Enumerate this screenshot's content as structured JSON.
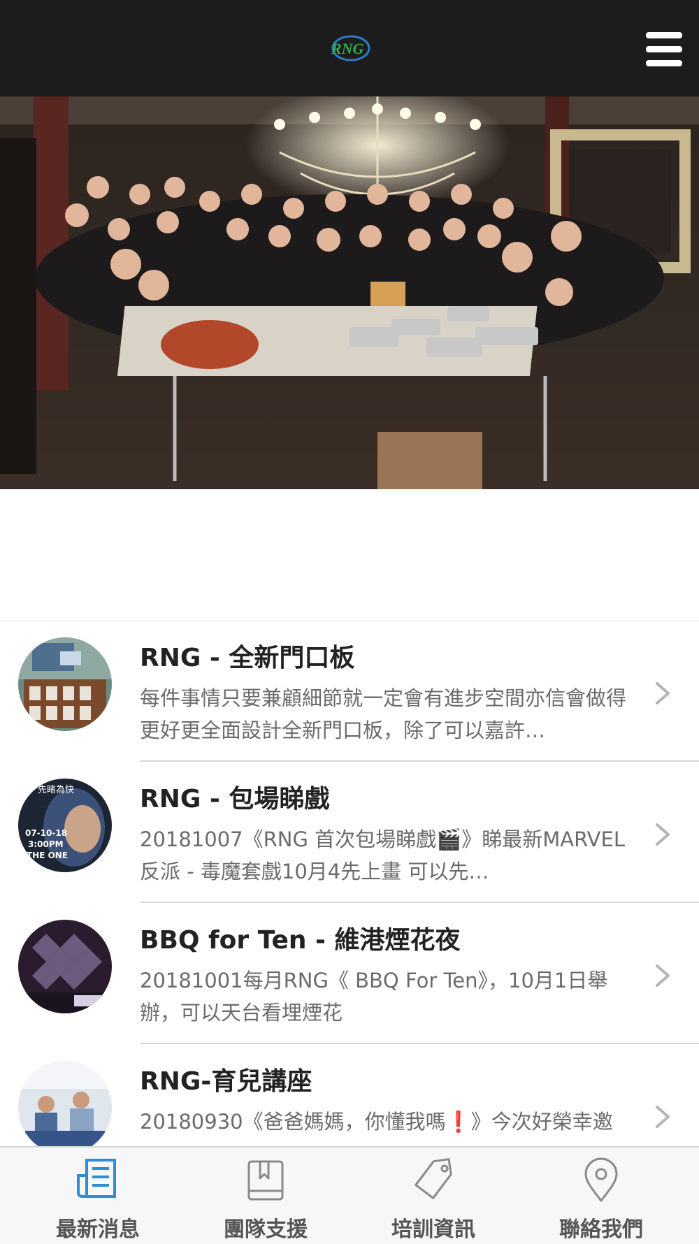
{
  "header": {
    "logo_text": "RNG",
    "menu_icon": "hamburger-menu-icon"
  },
  "colors": {
    "header_bg": "#1c1c1c",
    "tab_active": "#2a8fd6",
    "tab_inactive": "#8a8a8a",
    "title_text": "#222222",
    "excerpt_text": "#6b6b6b"
  },
  "news": [
    {
      "title": "RNG - 全新門口板",
      "excerpt": "每件事情只要兼顧細節就一定會有進步空間亦信會做得更好更全面設計全新門口板，除了可以嘉許…"
    },
    {
      "title": "RNG - 包場睇戲",
      "excerpt": "20181007《RNG 首次包場睇戲🎬》睇最新MARVEL 反派 - 毒魔套戲10月4先上畫 可以先…",
      "thumb_text": [
        "先睹為快",
        "07-10-18",
        "3:00PM",
        "THE ONE"
      ]
    },
    {
      "title": "BBQ for Ten - 維港煙花夜",
      "excerpt": "20181001每月RNG《 BBQ For Ten》，10月1日舉辦，可以天台看埋煙花"
    },
    {
      "title": "RNG-育兒講座",
      "excerpt": "20180930《爸爸媽媽，你懂我嗎❗》今次好榮幸邀"
    }
  ],
  "tabs": [
    {
      "label": "最新消息",
      "icon": "newspaper-icon",
      "active": true
    },
    {
      "label": "團隊支援",
      "icon": "book-icon",
      "active": false
    },
    {
      "label": "培訓資訊",
      "icon": "tag-icon",
      "active": false
    },
    {
      "label": "聯絡我們",
      "icon": "location-pin-icon",
      "active": false
    }
  ]
}
